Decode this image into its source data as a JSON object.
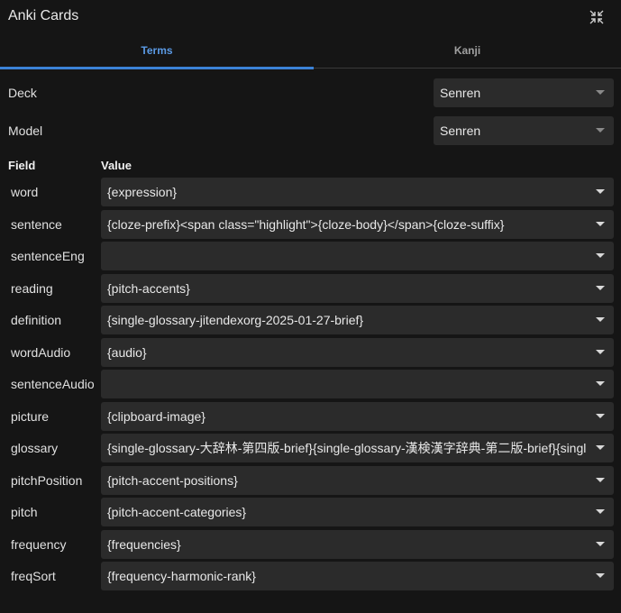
{
  "header": {
    "title": "Anki Cards"
  },
  "tabs": [
    {
      "label": "Terms",
      "active": true
    },
    {
      "label": "Kanji",
      "active": false
    }
  ],
  "deck": {
    "label": "Deck",
    "value": "Senren"
  },
  "model": {
    "label": "Model",
    "value": "Senren"
  },
  "columns": {
    "field": "Field",
    "value": "Value"
  },
  "fields": [
    {
      "name": "word",
      "value": "{expression}"
    },
    {
      "name": "sentence",
      "value": "{cloze-prefix}<span class=\"highlight\">{cloze-body}</span>{cloze-suffix}"
    },
    {
      "name": "sentenceEng",
      "value": ""
    },
    {
      "name": "reading",
      "value": "{pitch-accents}"
    },
    {
      "name": "definition",
      "value": "{single-glossary-jitendexorg-2025-01-27-brief}"
    },
    {
      "name": "wordAudio",
      "value": "{audio}"
    },
    {
      "name": "sentenceAudio",
      "value": ""
    },
    {
      "name": "picture",
      "value": "{clipboard-image}"
    },
    {
      "name": "glossary",
      "value": "{single-glossary-大辞林-第四版-brief}{single-glossary-漢検漢字辞典-第二版-brief}{single-"
    },
    {
      "name": "pitchPosition",
      "value": "{pitch-accent-positions}"
    },
    {
      "name": "pitch",
      "value": "{pitch-accent-categories}"
    },
    {
      "name": "frequency",
      "value": "{frequencies}"
    },
    {
      "name": "freqSort",
      "value": "{frequency-harmonic-rank}"
    }
  ],
  "colors": {
    "accent": "#3b82d6",
    "background": "#151515",
    "input": "#2b2b2b"
  }
}
